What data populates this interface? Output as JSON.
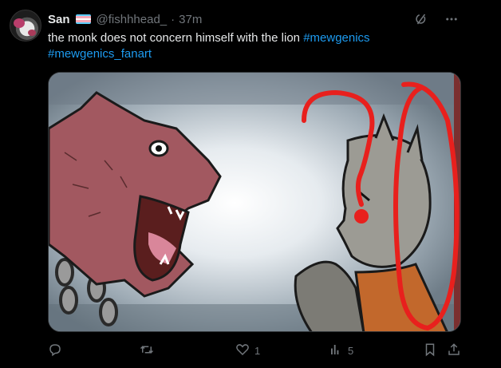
{
  "author": {
    "name": "San",
    "handle": "@fishhhead_",
    "separator": "·",
    "time": "37m",
    "flag_colors": [
      "#5bcefa",
      "#f5a9b8",
      "#ffffff",
      "#f5a9b8",
      "#5bcefa"
    ]
  },
  "tweet": {
    "text": "the monk does not concern himself with the lion",
    "hashtags": [
      "#mewgenics",
      "#mewgenics_fanart"
    ]
  },
  "media": {
    "icon": "artwork-image",
    "annotation_color": "#e8201d"
  },
  "actions": {
    "reply": {
      "icon": "reply-icon",
      "count": ""
    },
    "retweet": {
      "icon": "retweet-icon",
      "count": ""
    },
    "like": {
      "icon": "heart-icon",
      "count": "1"
    },
    "views": {
      "icon": "views-icon",
      "count": "5"
    },
    "bookmark": {
      "icon": "bookmark-icon"
    },
    "share": {
      "icon": "share-icon"
    }
  },
  "colors": {
    "accent": "#1d9bf0",
    "muted": "#71767b",
    "text": "#e7e9ea",
    "background": "#000000"
  }
}
